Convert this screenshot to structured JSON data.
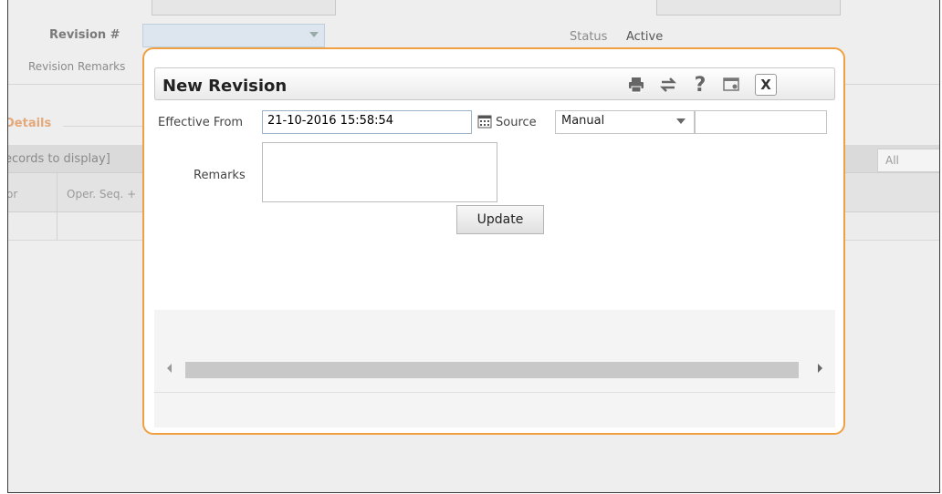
{
  "background": {
    "revision_label": "Revision #",
    "revision_remarks_label": "Revision Remarks",
    "status_label": "Status",
    "status_value": "Active",
    "details_label": "Details",
    "records_text": "ecords to display]",
    "columns": [
      "or",
      "Oper. Seq. +"
    ],
    "filter_value": "All"
  },
  "modal": {
    "title": "New Revision",
    "toolbar": {
      "print_icon": "print-icon",
      "swap_icon": "swap-icon",
      "help_icon": "help-icon",
      "window_icon": "window-settings-icon",
      "close_label": "X"
    },
    "effective_from_label": "Effective From",
    "effective_from_value": "21-10-2016 15:58:54",
    "source_label": "Source",
    "source_value": "Manual",
    "remarks_label": "Remarks",
    "remarks_value": "",
    "update_label": "Update"
  },
  "colors": {
    "modal_border": "#f0a040",
    "details_text": "#e4a87a",
    "input_border": "#9cb3c8"
  }
}
